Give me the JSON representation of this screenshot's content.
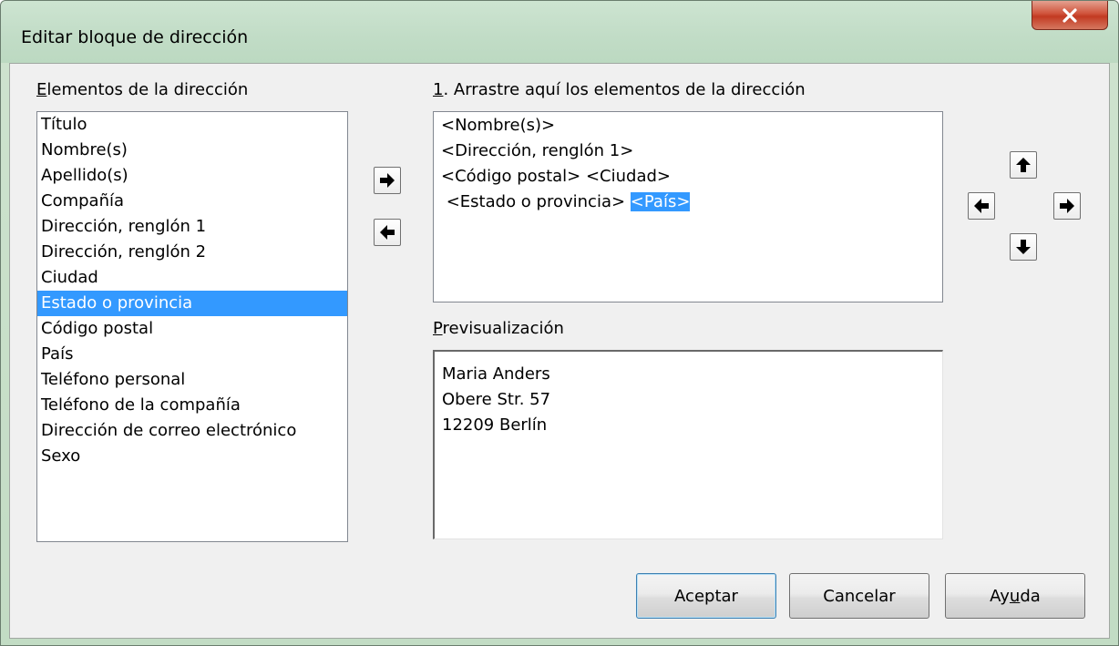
{
  "window": {
    "title": "Editar bloque de dirección"
  },
  "elements": {
    "label_first": "E",
    "label_rest": "lementos de la dirección",
    "items": [
      "Título",
      "Nombre(s)",
      "Apellido(s)",
      "Compañía",
      "Dirección, renglón 1",
      "Dirección, renglón 2",
      "Ciudad",
      "Estado o provincia",
      "Código postal",
      "País",
      "Teléfono personal",
      "Teléfono de la compañía",
      "Dirección de correo electrónico",
      "Sexo"
    ],
    "selected": "Estado o provincia"
  },
  "drag": {
    "label_first": "1",
    "label_rest": ". Arrastre aquí los elementos de la dirección",
    "line1": "<Nombre(s)>",
    "line2": "<Dirección, renglón 1>",
    "line3": "<Código postal> <Ciudad>",
    "line4_a": " <Estado o provincia> ",
    "line4_b": "<País>"
  },
  "preview": {
    "label_first": "P",
    "label_rest": "revisualización",
    "line1": "Maria Anders",
    "line2": "Obere Str. 57",
    "line3": "12209 Berlín"
  },
  "buttons": {
    "ok": "Aceptar",
    "cancel": "Cancelar",
    "help_a": "Ay",
    "help_u": "u",
    "help_b": "da"
  },
  "icons": {
    "close": "close-icon",
    "add": "arrow-right-icon",
    "remove": "arrow-left-icon",
    "up": "arrow-up-icon",
    "down": "arrow-down-icon",
    "left": "arrow-left-icon",
    "right": "arrow-right-icon"
  },
  "colors": {
    "selection": "#3399ff",
    "close_button": "#c8452d",
    "dialog_bg": "#f0f0f0"
  }
}
